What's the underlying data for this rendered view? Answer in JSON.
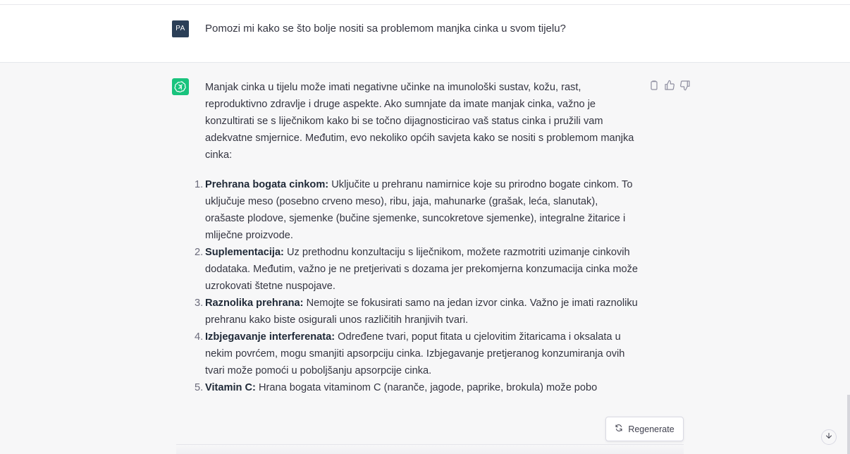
{
  "user_message": {
    "avatar_initials": "PA",
    "text": "Pomozi mi kako se što bolje nositi sa problemom manjka cinka u svom tijelu?"
  },
  "assistant_message": {
    "intro": "Manjak cinka u tijelu može imati negativne učinke na imunološki sustav, kožu, rast, reproduktivno zdravlje i druge aspekte. Ako sumnjate da imate manjak cinka, važno je konzultirati se s liječnikom kako bi se točno dijagnosticirao vaš status cinka i pružili vam adekvatne smjernice. Međutim, evo nekoliko općih savjeta kako se nositi s problemom manjka cinka:",
    "items": [
      {
        "number": "1.",
        "title": "Prehrana bogata cinkom:",
        "text": "Uključite u prehranu namirnice koje su prirodno bogate cinkom. To uključuje meso (posebno crveno meso), ribu, jaja, mahunarke (grašak, leća, slanutak), orašaste plodove, sjemenke (bučine sjemenke, suncokretove sjemenke), integralne žitarice i mliječne proizvode."
      },
      {
        "number": "2.",
        "title": "Suplementacija:",
        "text": "Uz prethodnu konzultaciju s liječnikom, možete razmotriti uzimanje cinkovih dodataka. Međutim, važno je ne pretjerivati s dozama jer prekomjerna konzumacija cinka može uzrokovati štetne nuspojave."
      },
      {
        "number": "3.",
        "title": "Raznolika prehrana:",
        "text": "Nemojte se fokusirati samo na jedan izvor cinka. Važno je imati raznoliku prehranu kako biste osigurali unos različitih hranjivih tvari."
      },
      {
        "number": "4.",
        "title": "Izbjegavanje interferenata:",
        "text": "Određene tvari, poput fitata u cjelovitim žitaricama i oksalata u nekim povrćem, mogu smanjiti apsorpciju cinka. Izbjegavanje pretjeranog konzumiranja ovih tvari može pomoći u poboljšanju apsorpcije cinka."
      },
      {
        "number": "5.",
        "title": "Vitamin C:",
        "text": "Hrana bogata vitaminom C (naranče, jagode, paprike, brokula) može pobo"
      }
    ],
    "icons": {
      "copy": "clipboard-icon",
      "like": "thumbs-up-icon",
      "dislike": "thumbs-down-icon"
    }
  },
  "regenerate": {
    "label": "Regenerate",
    "icon": "refresh-icon"
  },
  "scroll_button": {
    "icon": "arrow-down-icon"
  },
  "colors": {
    "user_avatar_bg": "#2b3f57",
    "gpt_avatar_bg": "#19c37d",
    "assistant_bg": "#f7f7f8",
    "text": "#343541"
  }
}
